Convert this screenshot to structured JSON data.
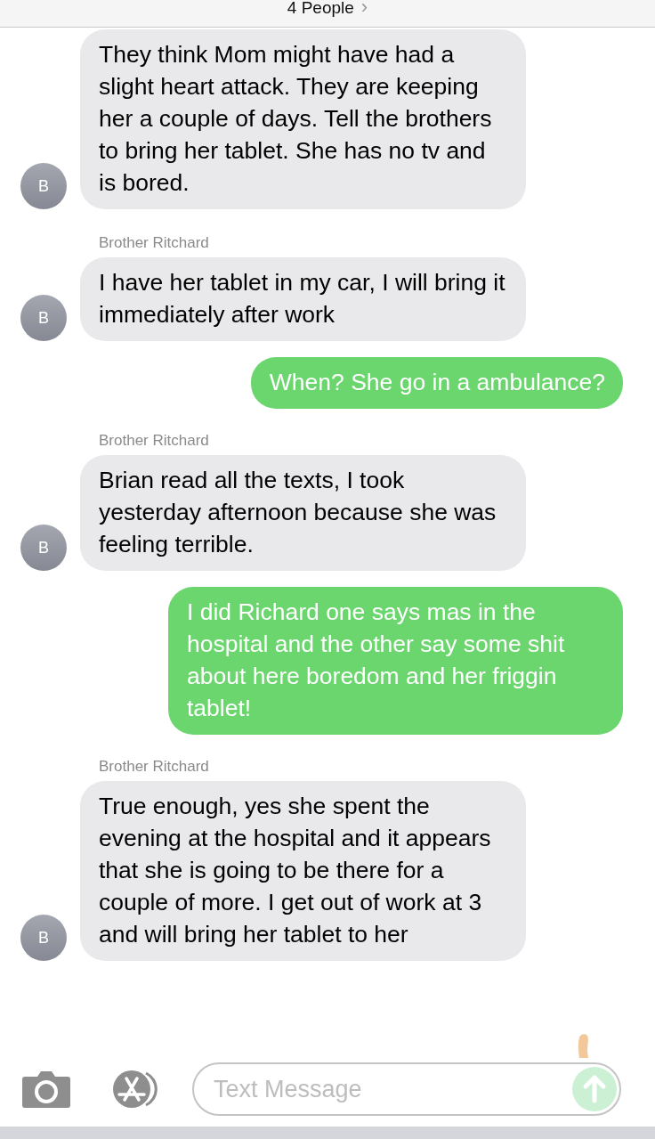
{
  "header": {
    "title": "4 People",
    "chevron": "›"
  },
  "messages": [
    {
      "kind": "incoming",
      "avatar": "B",
      "text": "They think Mom might have had a slight heart attack. They are keeping her a couple of days. Tell the brothers to bring her tablet. She has no tv and is bored."
    },
    {
      "kind": "incoming",
      "sender": "Brother Ritchard",
      "avatar": "B",
      "text": "I have her tablet in my car, I will bring it immediately after work"
    },
    {
      "kind": "outgoing",
      "text": "When? She go in a ambulance?"
    },
    {
      "kind": "incoming",
      "sender": "Brother Ritchard",
      "avatar": "B",
      "text": "Brian read all the texts, I took yesterday afternoon because she was feeling terrible."
    },
    {
      "kind": "outgoing",
      "text": "I did Richard one says mas in the hospital and the other say some shit about here boredom and her friggin tablet!"
    },
    {
      "kind": "incoming",
      "sender": "Brother Ritchard",
      "avatar": "B",
      "text": "True enough, yes she spent the evening at the hospital and it appears that she is going to be there for a couple of more. I get out of work at 3 and will bring her tablet to her"
    }
  ],
  "composer": {
    "placeholder": "Text Message",
    "send_disabled": true
  }
}
